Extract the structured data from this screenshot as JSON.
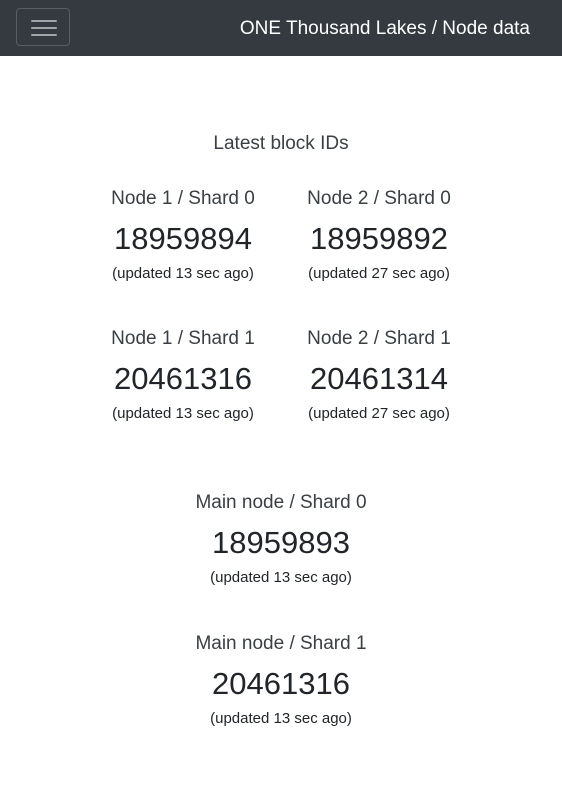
{
  "navbar": {
    "toggle_icon": "hamburger-menu-icon",
    "brand": "ONE Thousand Lakes / Node data",
    "background": "#343a40"
  },
  "latest": {
    "title": "Latest block IDs",
    "blocks": [
      {
        "label": "Node 1 / Shard 0",
        "value": "18959894",
        "updated": "(updated 13 sec ago)"
      },
      {
        "label": "Node 2 / Shard 0",
        "value": "18959892",
        "updated": "(updated 27 sec ago)"
      },
      {
        "label": "Node 1 / Shard 1",
        "value": "20461316",
        "updated": "(updated 13 sec ago)"
      },
      {
        "label": "Node 2 / Shard 1",
        "value": "20461314",
        "updated": "(updated 27 sec ago)"
      }
    ]
  },
  "main_node": {
    "blocks": [
      {
        "label": "Main node / Shard 0",
        "value": "18959893",
        "updated": "(updated 13 sec ago)"
      },
      {
        "label": "Main node / Shard 1",
        "value": "20461316",
        "updated": "(updated 13 sec ago)"
      }
    ]
  }
}
